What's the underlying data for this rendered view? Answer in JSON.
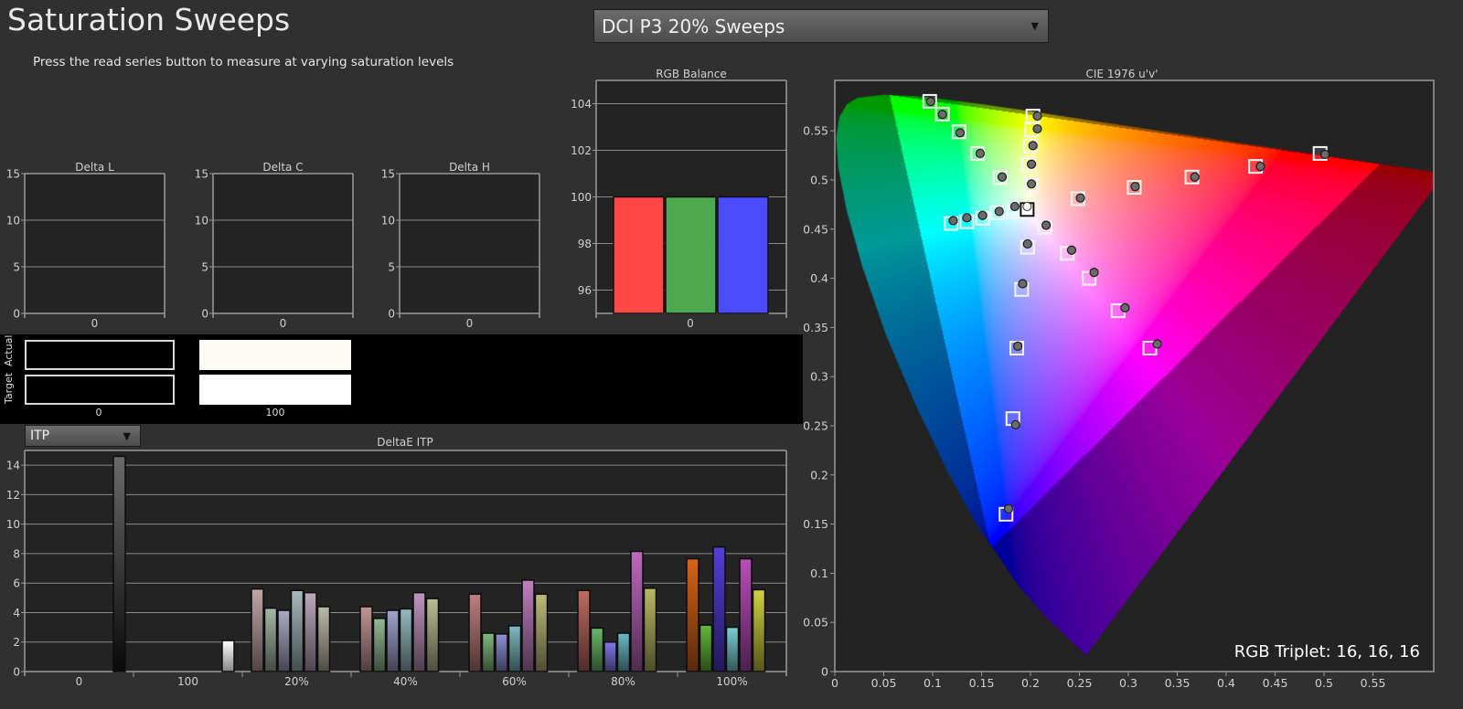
{
  "header": {
    "title": "Saturation Sweeps",
    "instruction": "Press the read series button to measure at varying saturation levels"
  },
  "series_select": {
    "value": "DCI P3 20% Sweeps",
    "icon": "dropdown-arrow-icon"
  },
  "metric_select": {
    "value": "ITP",
    "icon": "dropdown-arrow-icon"
  },
  "swatches": {
    "actual_label": "Actual",
    "target_label": "Target",
    "items": [
      {
        "label": "0",
        "actual": "#000000",
        "target": "#000000"
      },
      {
        "label": "100",
        "actual": "#fcfcf4",
        "target": "#ffffff"
      }
    ]
  },
  "cie_readout": "RGB Triplet: 16, 16, 16",
  "chart_data": [
    {
      "type": "bar",
      "title": "Delta L",
      "categories": [
        "0"
      ],
      "values": [],
      "ylim": [
        0,
        15
      ],
      "yticks": [
        "0",
        "5",
        "10",
        "15"
      ]
    },
    {
      "type": "bar",
      "title": "Delta C",
      "categories": [
        "0"
      ],
      "values": [],
      "ylim": [
        0,
        15
      ],
      "yticks": [
        "0",
        "5",
        "10",
        "15"
      ]
    },
    {
      "type": "bar",
      "title": "Delta H",
      "categories": [
        "0"
      ],
      "values": [],
      "ylim": [
        0,
        15
      ],
      "yticks": [
        "0",
        "5",
        "10",
        "15"
      ]
    },
    {
      "type": "bar",
      "title": "RGB Balance",
      "categories": [
        "0"
      ],
      "values": [
        100,
        100,
        100
      ],
      "colors": [
        "#ff4848",
        "#4ea84e",
        "#4c4cff"
      ],
      "ylim": [
        95,
        105
      ],
      "yticks": [
        "96",
        "98",
        "100",
        "102",
        "104"
      ]
    },
    {
      "type": "bar",
      "title": "DeltaE ITP",
      "ylim": [
        0,
        15
      ],
      "yticks": [
        "0",
        "2",
        "4",
        "6",
        "8",
        "10",
        "12",
        "14"
      ],
      "groups": [
        {
          "label": "0",
          "values": [
            14.6
          ],
          "colors": [
            "#2a2a2a"
          ]
        },
        {
          "label": "100",
          "values": [
            2.1
          ],
          "colors": [
            "#f0f0f0"
          ]
        },
        {
          "label": "20%",
          "values": [
            5.6,
            4.3,
            4.15,
            5.5,
            5.35,
            4.4
          ],
          "colors": [
            "#8f7c7c",
            "#7c887c",
            "#7e7e92",
            "#7c8a8c",
            "#8c7e8c",
            "#8a8a7c"
          ]
        },
        {
          "label": "40%",
          "values": [
            4.4,
            3.6,
            4.15,
            4.25,
            5.35,
            4.95
          ],
          "colors": [
            "#8f6e6e",
            "#6e8a6e",
            "#78789a",
            "#6e8a90",
            "#8e6e8e",
            "#8c8c6c"
          ]
        },
        {
          "label": "60%",
          "values": [
            5.25,
            2.6,
            2.55,
            3.1,
            6.2,
            5.25
          ],
          "colors": [
            "#8e5e5e",
            "#5e8a5e",
            "#6a6aa0",
            "#5e8a90",
            "#8e5e8e",
            "#8c8c5c"
          ]
        },
        {
          "label": "80%",
          "values": [
            5.5,
            2.95,
            2.0,
            2.6,
            8.15,
            5.65
          ],
          "colors": [
            "#8c5048",
            "#4e8a4e",
            "#5e5ab0",
            "#4e8a94",
            "#8e4e8e",
            "#8a8a4a"
          ]
        },
        {
          "label": "100%",
          "values": [
            7.65,
            3.15,
            8.45,
            3.0,
            7.65,
            5.55
          ],
          "colors": [
            "#a04a10",
            "#4a8a2a",
            "#3e2ea0",
            "#5a9aa0",
            "#8a3a8a",
            "#9a9a30"
          ]
        }
      ]
    },
    {
      "type": "scatter",
      "title": "CIE 1976 u'v'",
      "xlim": [
        0,
        0.612
      ],
      "ylim": [
        0,
        0.601
      ],
      "xticks": [
        "0",
        "0.05",
        "0.1",
        "0.15",
        "0.2",
        "0.25",
        "0.3",
        "0.35",
        "0.4",
        "0.45",
        "0.5",
        "0.55"
      ],
      "yticks": [
        "0",
        "0.05",
        "0.1",
        "0.15",
        "0.2",
        "0.25",
        "0.3",
        "0.35",
        "0.4",
        "0.45",
        "0.5",
        "0.55"
      ],
      "white_point": {
        "target": [
          0.1966,
          0.47
        ],
        "measured": [
          0.1966,
          0.473
        ]
      },
      "targets": [
        [
          0.097,
          0.58
        ],
        [
          0.11,
          0.567
        ],
        [
          0.127,
          0.549
        ],
        [
          0.146,
          0.527
        ],
        [
          0.169,
          0.5025
        ],
        [
          0.1827,
          0.468
        ],
        [
          0.166,
          0.4667
        ],
        [
          0.151,
          0.461
        ],
        [
          0.135,
          0.4575
        ],
        [
          0.119,
          0.4558
        ],
        [
          0.201,
          0.495
        ],
        [
          0.198,
          0.516
        ],
        [
          0.2,
          0.5346
        ],
        [
          0.2013,
          0.551
        ],
        [
          0.2025,
          0.565
        ],
        [
          0.2148,
          0.452
        ],
        [
          0.2485,
          0.481
        ],
        [
          0.306,
          0.4925
        ],
        [
          0.365,
          0.503
        ],
        [
          0.43,
          0.5138
        ],
        [
          0.496,
          0.527
        ],
        [
          0.2376,
          0.4254
        ],
        [
          0.26,
          0.4
        ],
        [
          0.2895,
          0.367
        ],
        [
          0.322,
          0.329
        ],
        [
          0.197,
          0.4316
        ],
        [
          0.191,
          0.3887
        ],
        [
          0.186,
          0.329
        ],
        [
          0.182,
          0.2573
        ],
        [
          0.175,
          0.16
        ]
      ],
      "measured": [
        [
          0.0979,
          0.5797
        ],
        [
          0.11,
          0.5667
        ],
        [
          0.128,
          0.548
        ],
        [
          0.1485,
          0.527
        ],
        [
          0.171,
          0.503
        ],
        [
          0.184,
          0.473
        ],
        [
          0.168,
          0.468
        ],
        [
          0.151,
          0.464
        ],
        [
          0.135,
          0.4616
        ],
        [
          0.121,
          0.4587
        ],
        [
          0.201,
          0.496
        ],
        [
          0.201,
          0.516
        ],
        [
          0.2025,
          0.535
        ],
        [
          0.207,
          0.552
        ],
        [
          0.207,
          0.565
        ],
        [
          0.216,
          0.454
        ],
        [
          0.251,
          0.4817
        ],
        [
          0.307,
          0.4933
        ],
        [
          0.368,
          0.503
        ],
        [
          0.435,
          0.5138
        ],
        [
          0.501,
          0.526
        ],
        [
          0.242,
          0.4287
        ],
        [
          0.265,
          0.406
        ],
        [
          0.2966,
          0.37
        ],
        [
          0.3295,
          0.3332
        ],
        [
          0.197,
          0.435
        ],
        [
          0.192,
          0.3945
        ],
        [
          0.187,
          0.331
        ],
        [
          0.1848,
          0.251
        ],
        [
          0.1776,
          0.1656
        ]
      ]
    }
  ]
}
